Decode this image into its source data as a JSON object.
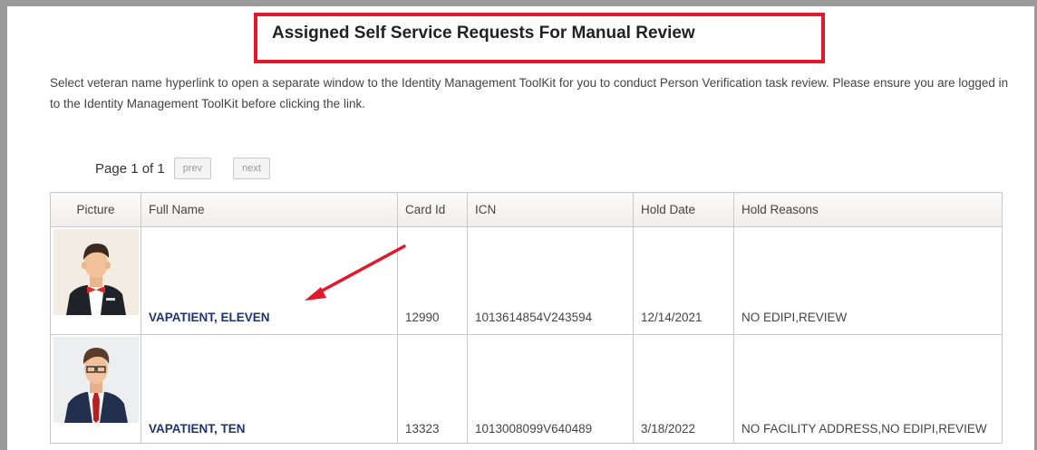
{
  "header": {
    "title": "Assigned Self Service Requests For Manual Review"
  },
  "instructions": "Select veteran name hyperlink to open a separate window to the Identity Management ToolKit for you to conduct Person Verification task review. Please ensure you are logged in to the Identity Management ToolKit before clicking the link.",
  "pager": {
    "label": "Page 1 of 1",
    "prev_label": "prev",
    "next_label": "next"
  },
  "table": {
    "columns": {
      "picture": "Picture",
      "full_name": "Full Name",
      "card_id": "Card Id",
      "icn": "ICN",
      "hold_date": "Hold Date",
      "hold_reasons": "Hold Reasons"
    },
    "rows": [
      {
        "full_name": "VAPATIENT, ELEVEN",
        "card_id": "12990",
        "icn": "1013614854V243594",
        "hold_date": "12/14/2021",
        "hold_reasons": "NO EDIPI,REVIEW",
        "avatar_icon": "person-bowtie-avatar-icon"
      },
      {
        "full_name": "VAPATIENT, TEN",
        "card_id": "13323",
        "icn": "1013008099V640489",
        "hold_date": "3/18/2022",
        "hold_reasons": "NO FACILITY ADDRESS,NO EDIPI,REVIEW",
        "avatar_icon": "person-glasses-avatar-icon"
      }
    ]
  },
  "colors": {
    "highlight_box": "#e0192c",
    "annotation_arrow": "#e0192c",
    "link": "#1e3372"
  }
}
